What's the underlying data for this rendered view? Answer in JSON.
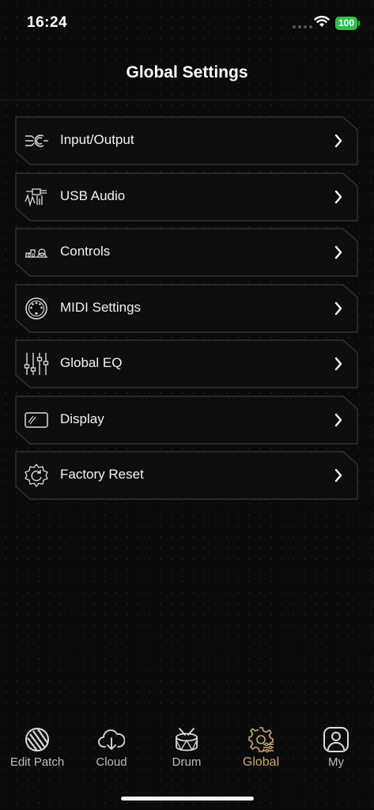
{
  "status": {
    "time": "16:24",
    "battery": "100"
  },
  "header": {
    "title": "Global Settings"
  },
  "menu": {
    "items": [
      {
        "label": "Input/Output",
        "icon": "input-output-icon"
      },
      {
        "label": "USB Audio",
        "icon": "usb-audio-icon"
      },
      {
        "label": "Controls",
        "icon": "controls-icon"
      },
      {
        "label": "MIDI Settings",
        "icon": "midi-icon"
      },
      {
        "label": "Global EQ",
        "icon": "eq-sliders-icon"
      },
      {
        "label": "Display",
        "icon": "display-icon"
      },
      {
        "label": "Factory Reset",
        "icon": "factory-reset-icon"
      }
    ]
  },
  "tabbar": {
    "tabs": [
      {
        "label": "Edit Patch",
        "icon": "edit-patch-icon"
      },
      {
        "label": "Cloud",
        "icon": "cloud-download-icon"
      },
      {
        "label": "Drum",
        "icon": "drum-icon"
      },
      {
        "label": "Global",
        "icon": "gear-icon",
        "active": true
      },
      {
        "label": "My",
        "icon": "user-icon"
      }
    ]
  },
  "colors": {
    "accent": "#c9a86a",
    "background": "#0b0b0b",
    "frame": "#3a3a3a"
  }
}
